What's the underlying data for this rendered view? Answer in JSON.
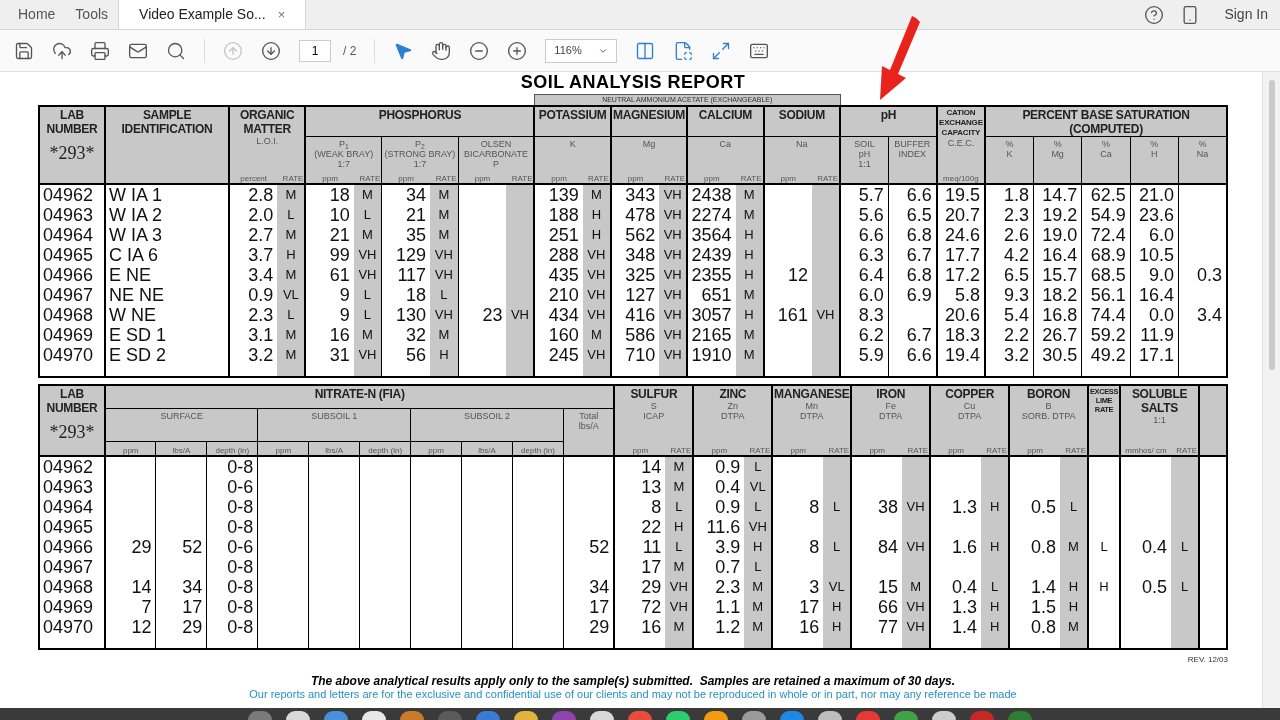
{
  "tabs": [
    {
      "label": "Home",
      "selected": false
    },
    {
      "label": "Tools",
      "selected": false
    },
    {
      "label": "Video Example So...",
      "selected": true,
      "close": "×"
    }
  ],
  "sign_in": "Sign In",
  "toolbar": {
    "prev_disabled": true,
    "page": "1",
    "page_total": "/ 2",
    "zoom": "116%"
  },
  "report": {
    "title": "SOIL ANALYSIS REPORT",
    "top_table": {
      "groups": [
        {
          "title": "LAB NUMBER",
          "ruled": false,
          "parts": [
            {
              "code": "*293*",
              "columns": [
                {
                  "kind": "lab"
                }
              ]
            }
          ]
        },
        {
          "title": "SAMPLE IDENTIFICATION",
          "ruled": false,
          "parts": [
            {
              "columns": [
                {
                  "kind": "name"
                }
              ]
            }
          ]
        },
        {
          "title": "ORGANIC MATTER",
          "ruled": false,
          "parts": [
            {
              "lines": [
                "L.O.I."
              ],
              "columns": [
                {
                  "kind": "value",
                  "text": "percent"
                },
                {
                  "kind": "rate",
                  "text": "RATE"
                }
              ]
            }
          ]
        },
        {
          "title": "PHOSPHORUS",
          "ruled": true,
          "parts": [
            {
              "lines": [
                "P$_{1}$",
                "(WEAK BRAY)",
                "1:7"
              ],
              "columns": [
                {
                  "kind": "value",
                  "text": "ppm"
                },
                {
                  "kind": "rate",
                  "text": "RATE"
                }
              ]
            },
            {
              "lines": [
                "P$_{2}$",
                "(STRONG BRAY)",
                "1:7"
              ],
              "columns": [
                {
                  "kind": "value",
                  "text": "ppm"
                },
                {
                  "kind": "rate",
                  "text": "RATE"
                }
              ]
            },
            {
              "lines": [
                "OLSEN",
                "BICARBONATE",
                "P"
              ],
              "columns": [
                {
                  "kind": "value",
                  "text": "ppm"
                },
                {
                  "kind": "rate",
                  "text": "RATE"
                }
              ]
            }
          ]
        },
        {
          "kind": "banner",
          "text": "NEUTRAL AMMONIUM ACETATE (EXCHANGEABLE)",
          "groups": [
            {
              "title": "POTASSIUM",
              "ruled": true,
              "parts": [
                {
                  "lines": [
                    "K"
                  ],
                  "columns": [
                    {
                      "kind": "value",
                      "text": "ppm"
                    },
                    {
                      "kind": "rate",
                      "text": "RATE"
                    }
                  ]
                }
              ]
            },
            {
              "title": "MAGNESIUM",
              "ruled": true,
              "parts": [
                {
                  "lines": [
                    "Mg"
                  ],
                  "columns": [
                    {
                      "kind": "value",
                      "text": "ppm"
                    },
                    {
                      "kind": "rate",
                      "text": "RATE"
                    }
                  ]
                }
              ]
            },
            {
              "title": "CALCIUM",
              "ruled": true,
              "parts": [
                {
                  "lines": [
                    "Ca"
                  ],
                  "columns": [
                    {
                      "kind": "value",
                      "text": "ppm"
                    },
                    {
                      "kind": "rate",
                      "text": "RATE"
                    }
                  ]
                }
              ]
            },
            {
              "title": "SODIUM",
              "ruled": true,
              "parts": [
                {
                  "lines": [
                    "Na"
                  ],
                  "columns": [
                    {
                      "kind": "value",
                      "text": "ppm"
                    },
                    {
                      "kind": "rate",
                      "text": "RATE"
                    }
                  ]
                }
              ]
            }
          ]
        },
        {
          "title": "pH",
          "ruled": true,
          "parts": [
            {
              "lines": [
                "SOIL",
                "pH",
                "1:1"
              ],
              "columns": [
                {
                  "kind": "value"
                }
              ]
            },
            {
              "lines": [
                "BUFFER",
                "INDEX"
              ],
              "columns": [
                {
                  "kind": "value"
                }
              ]
            }
          ]
        },
        {
          "title": "CATION EXCHANGE CAPACITY",
          "ruled": false,
          "parts": [
            {
              "lines": [
                "C.E.C."
              ],
              "columns": [
                {
                  "kind": "value",
                  "text": "meq/100g"
                }
              ]
            }
          ]
        },
        {
          "title": "PERCENT BASE SATURATION (COMPUTED)",
          "ruled": true,
          "parts": [
            {
              "lines": [
                "%",
                "K"
              ],
              "columns": [
                {
                  "kind": "value"
                }
              ]
            },
            {
              "lines": [
                "%",
                "Mg"
              ],
              "columns": [
                {
                  "kind": "value"
                }
              ]
            },
            {
              "lines": [
                "%",
                "Ca"
              ],
              "columns": [
                {
                  "kind": "value"
                }
              ]
            },
            {
              "lines": [
                "%",
                "H"
              ],
              "columns": [
                {
                  "kind": "value"
                }
              ]
            },
            {
              "lines": [
                "%",
                "Na"
              ],
              "columns": [
                {
                  "kind": "value"
                }
              ]
            }
          ]
        }
      ],
      "rows": [
        [
          "04962",
          "W IA 1",
          "2.8",
          "M",
          "18",
          "M",
          "34",
          "M",
          null,
          null,
          "139",
          "M",
          "343",
          "VH",
          "2438",
          "M",
          null,
          null,
          "5.7",
          "6.6",
          "19.5",
          "1.8",
          "14.7",
          "62.5",
          "21.0",
          null
        ],
        [
          "04963",
          "W IA 2",
          "2.0",
          "L",
          "10",
          "L",
          "21",
          "M",
          null,
          null,
          "188",
          "H",
          "478",
          "VH",
          "2274",
          "M",
          null,
          null,
          "5.6",
          "6.5",
          "20.7",
          "2.3",
          "19.2",
          "54.9",
          "23.6",
          null
        ],
        [
          "04964",
          "W IA 3",
          "2.7",
          "M",
          "21",
          "M",
          "35",
          "M",
          null,
          null,
          "251",
          "H",
          "562",
          "VH",
          "3564",
          "H",
          null,
          null,
          "6.6",
          "6.8",
          "24.6",
          "2.6",
          "19.0",
          "72.4",
          "6.0",
          null
        ],
        [
          "04965",
          "C IA 6",
          "3.7",
          "H",
          "99",
          "VH",
          "129",
          "VH",
          null,
          null,
          "288",
          "VH",
          "348",
          "VH",
          "2439",
          "H",
          null,
          null,
          "6.3",
          "6.7",
          "17.7",
          "4.2",
          "16.4",
          "68.9",
          "10.5",
          null
        ],
        [
          "04966",
          "E NE",
          "3.4",
          "M",
          "61",
          "VH",
          "117",
          "VH",
          null,
          null,
          "435",
          "VH",
          "325",
          "VH",
          "2355",
          "H",
          "12",
          null,
          "6.4",
          "6.8",
          "17.2",
          "6.5",
          "15.7",
          "68.5",
          "9.0",
          "0.3"
        ],
        [
          "04967",
          "NE NE",
          "0.9",
          "VL",
          "9",
          "L",
          "18",
          "L",
          null,
          null,
          "210",
          "VH",
          "127",
          "VH",
          "651",
          "M",
          null,
          null,
          "6.0",
          "6.9",
          "5.8",
          "9.3",
          "18.2",
          "56.1",
          "16.4",
          null
        ],
        [
          "04968",
          "W NE",
          "2.3",
          "L",
          "9",
          "L",
          "130",
          "VH",
          "23",
          "VH",
          "434",
          "VH",
          "416",
          "VH",
          "3057",
          "H",
          "161",
          "VH",
          "8.3",
          null,
          "20.6",
          "5.4",
          "16.8",
          "74.4",
          "0.0",
          "3.4"
        ],
        [
          "04969",
          "E SD 1",
          "3.1",
          "M",
          "16",
          "M",
          "32",
          "M",
          null,
          null,
          "160",
          "M",
          "586",
          "VH",
          "2165",
          "M",
          null,
          null,
          "6.2",
          "6.7",
          "18.3",
          "2.2",
          "26.7",
          "59.2",
          "11.9",
          null
        ],
        [
          "04970",
          "E SD 2",
          "3.2",
          "M",
          "31",
          "VH",
          "56",
          "H",
          null,
          null,
          "245",
          "VH",
          "710",
          "VH",
          "1910",
          "M",
          null,
          null,
          "5.9",
          "6.6",
          "19.4",
          "3.2",
          "30.5",
          "49.2",
          "17.1",
          null
        ]
      ]
    },
    "bottom_table": {
      "groups": [
        {
          "title": "LAB NUMBER",
          "ruled": false,
          "parts": [
            {
              "code": "*293*",
              "columns": [
                {
                  "kind": "lab"
                }
              ]
            }
          ]
        },
        {
          "title": "NITRATE-N (FIA)",
          "ruled": true,
          "parts": [
            {
              "lines": [
                "SURFACE"
              ],
              "ruled_columns": true,
              "columns": [
                {
                  "kind": "value",
                  "text": "ppm"
                },
                {
                  "kind": "value",
                  "text": "lbs/A"
                },
                {
                  "kind": "value",
                  "text": "depth (in)"
                }
              ]
            },
            {
              "lines": [
                "SUBSOIL 1"
              ],
              "ruled_columns": true,
              "columns": [
                {
                  "kind": "value",
                  "text": "ppm"
                },
                {
                  "kind": "value",
                  "text": "lbs/A"
                },
                {
                  "kind": "value",
                  "text": "depth (in)"
                }
              ]
            },
            {
              "lines": [
                "SUBSOIL 2"
              ],
              "ruled_columns": true,
              "columns": [
                {
                  "kind": "value",
                  "text": "ppm"
                },
                {
                  "kind": "value",
                  "text": "lbs/A"
                },
                {
                  "kind": "value",
                  "text": "depth (in)"
                }
              ]
            },
            {
              "lines": [
                "Total",
                "lbs/A"
              ],
              "columns": [
                {
                  "kind": "value"
                }
              ]
            }
          ]
        },
        {
          "title": "SULFUR",
          "ruled": false,
          "parts": [
            {
              "lines": [
                "S",
                "ICAP"
              ],
              "columns": [
                {
                  "kind": "value",
                  "text": "ppm"
                },
                {
                  "kind": "rate",
                  "text": "RATE"
                }
              ]
            }
          ]
        },
        {
          "title": "ZINC",
          "ruled": false,
          "parts": [
            {
              "lines": [
                "Zn",
                "DTPA"
              ],
              "columns": [
                {
                  "kind": "value",
                  "text": "ppm"
                },
                {
                  "kind": "rate",
                  "text": "RATE"
                }
              ]
            }
          ]
        },
        {
          "title": "MANGANESE",
          "ruled": false,
          "parts": [
            {
              "lines": [
                "Mn",
                "DTPA"
              ],
              "columns": [
                {
                  "kind": "value",
                  "text": "ppm"
                },
                {
                  "kind": "rate",
                  "text": "RATE"
                }
              ]
            }
          ]
        },
        {
          "title": "IRON",
          "ruled": false,
          "parts": [
            {
              "lines": [
                "Fe",
                "DTPA"
              ],
              "columns": [
                {
                  "kind": "value",
                  "text": "ppm"
                },
                {
                  "kind": "rate",
                  "text": "RATE"
                }
              ]
            }
          ]
        },
        {
          "title": "COPPER",
          "ruled": false,
          "parts": [
            {
              "lines": [
                "Cu",
                "DTPA"
              ],
              "columns": [
                {
                  "kind": "value",
                  "text": "ppm"
                },
                {
                  "kind": "rate",
                  "text": "RATE"
                }
              ]
            }
          ]
        },
        {
          "title": "BORON",
          "ruled": false,
          "parts": [
            {
              "lines": [
                "B",
                "SORB. DTPA"
              ],
              "columns": [
                {
                  "kind": "value",
                  "text": "ppm"
                },
                {
                  "kind": "rate",
                  "text": "RATE"
                }
              ]
            }
          ]
        },
        {
          "title": "EXCESS LIME RATE",
          "ruled": false,
          "parts": [
            {
              "columns": [
                {
                  "kind": "flag"
                }
              ]
            }
          ]
        },
        {
          "title": "SOLUBLE SALTS",
          "ruled": false,
          "parts": [
            {
              "lines": [
                "1:1"
              ],
              "columns": [
                {
                  "kind": "value",
                  "text": "mmhos/ cm"
                },
                {
                  "kind": "rate",
                  "text": "RATE"
                }
              ]
            }
          ]
        },
        {
          "ruled": false,
          "parts": [
            {
              "columns": [
                {
                  "kind": "blank"
                }
              ]
            }
          ]
        }
      ],
      "rows": [
        [
          "04962",
          null,
          null,
          "0-8",
          null,
          null,
          null,
          null,
          null,
          null,
          null,
          "14",
          "M",
          "0.9",
          "L",
          null,
          null,
          null,
          null,
          null,
          null,
          null,
          null,
          null,
          null,
          null,
          null
        ],
        [
          "04963",
          null,
          null,
          "0-6",
          null,
          null,
          null,
          null,
          null,
          null,
          null,
          "13",
          "M",
          "0.4",
          "VL",
          null,
          null,
          null,
          null,
          null,
          null,
          null,
          null,
          null,
          null,
          null,
          null
        ],
        [
          "04964",
          null,
          null,
          "0-8",
          null,
          null,
          null,
          null,
          null,
          null,
          null,
          "8",
          "L",
          "0.9",
          "L",
          "8",
          "L",
          "38",
          "VH",
          "1.3",
          "H",
          "0.5",
          "L",
          null,
          null,
          null,
          null
        ],
        [
          "04965",
          null,
          null,
          "0-8",
          null,
          null,
          null,
          null,
          null,
          null,
          null,
          "22",
          "H",
          "11.6",
          "VH",
          null,
          null,
          null,
          null,
          null,
          null,
          null,
          null,
          null,
          null,
          null,
          null
        ],
        [
          "04966",
          "29",
          "52",
          "0-6",
          null,
          null,
          null,
          null,
          null,
          null,
          "52",
          "11",
          "L",
          "3.9",
          "H",
          "8",
          "L",
          "84",
          "VH",
          "1.6",
          "H",
          "0.8",
          "M",
          "L",
          "0.4",
          "L",
          null
        ],
        [
          "04967",
          null,
          null,
          "0-8",
          null,
          null,
          null,
          null,
          null,
          null,
          null,
          "17",
          "M",
          "0.7",
          "L",
          null,
          null,
          null,
          null,
          null,
          null,
          null,
          null,
          null,
          null,
          null,
          null
        ],
        [
          "04968",
          "14",
          "34",
          "0-8",
          null,
          null,
          null,
          null,
          null,
          null,
          "34",
          "29",
          "VH",
          "2.3",
          "M",
          "3",
          "VL",
          "15",
          "M",
          "0.4",
          "L",
          "1.4",
          "H",
          "H",
          "0.5",
          "L",
          null
        ],
        [
          "04969",
          "7",
          "17",
          "0-8",
          null,
          null,
          null,
          null,
          null,
          null,
          "17",
          "72",
          "VH",
          "1.1",
          "M",
          "17",
          "H",
          "66",
          "VH",
          "1.3",
          "H",
          "1.5",
          "H",
          null,
          null,
          null,
          null
        ],
        [
          "04970",
          "12",
          "29",
          "0-8",
          null,
          null,
          null,
          null,
          null,
          null,
          "29",
          "16",
          "M",
          "1.2",
          "M",
          "16",
          "H",
          "77",
          "VH",
          "1.4",
          "H",
          "0.8",
          "M",
          null,
          null,
          null,
          null
        ]
      ]
    },
    "revision": "REV. 12/03",
    "note": "The above analytical results apply only to the sample(s) submitted.  Samples are retained a maximum of 30 days.",
    "disclaimer": "Our reports and letters are for the exclusive and confidential use of our clients and may not be reproduced in whole or in part, nor may any reference be made"
  }
}
